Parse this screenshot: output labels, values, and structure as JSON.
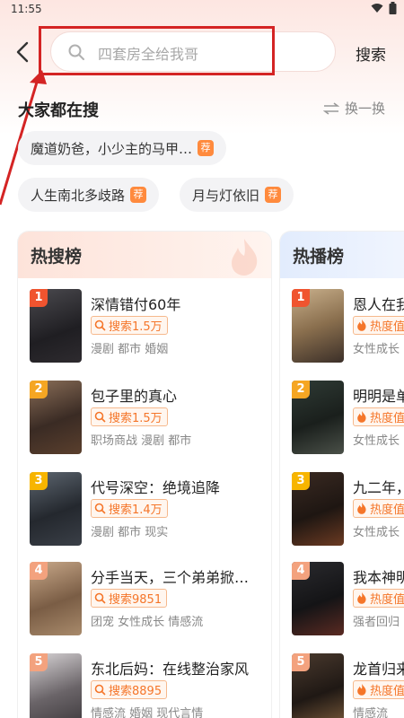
{
  "status": {
    "time": "11:55"
  },
  "search": {
    "placeholder": "四套房全给我哥",
    "button": "搜索"
  },
  "hot": {
    "title": "大家都在搜",
    "refresh": "换一换"
  },
  "chips": [
    {
      "label": "魔道奶爸，小少主的马甲…",
      "tag": "荐"
    },
    {
      "label": "人生南北多歧路",
      "tag": "荐"
    },
    {
      "label": "月与灯依旧",
      "tag": "荐"
    }
  ],
  "rank_left": {
    "title": "热搜榜",
    "items": [
      {
        "rank": "1",
        "title": "深情错付60年",
        "metric": "搜索1.5万",
        "tags": "漫剧 都市 婚姻"
      },
      {
        "rank": "2",
        "title": "包子里的真心",
        "metric": "搜索1.5万",
        "tags": "职场商战 漫剧 都市"
      },
      {
        "rank": "3",
        "title": "代号深空：绝境追降",
        "metric": "搜索1.4万",
        "tags": "漫剧 都市 现实"
      },
      {
        "rank": "4",
        "title": "分手当天，三个弟弟掀…",
        "metric": "搜索9851",
        "tags": "团宠 女性成长 情感流"
      },
      {
        "rank": "5",
        "title": "东北后妈：在线整治家风",
        "metric": "搜索8895",
        "tags": "情感流 婚姻 现代言情"
      }
    ]
  },
  "rank_right": {
    "title": "热播榜",
    "items": [
      {
        "rank": "1",
        "title": "恩人在我",
        "metric": "热度值",
        "tags": "女性成长"
      },
      {
        "rank": "2",
        "title": "明明是单",
        "metric": "热度值",
        "tags": "女性成长"
      },
      {
        "rank": "3",
        "title": "九二年，",
        "metric": "热度值",
        "tags": "女性成长"
      },
      {
        "rank": "4",
        "title": "我本神明",
        "metric": "热度值",
        "tags": "强者回归"
      },
      {
        "rank": "5",
        "title": "龙首归来",
        "metric": "热度值",
        "tags": "情感流"
      }
    ]
  },
  "colors": {
    "rank1": "#f0542f",
    "rank2": "#f5a623",
    "rank3": "#f7b500",
    "rank4": "#f3a27e",
    "rank5": "#f3a27e",
    "accent": "#f5762a",
    "highlight": "#d42424"
  },
  "icons": {
    "back": "chevron-left-icon",
    "search": "search-icon",
    "refresh": "swap-arrows-icon",
    "metric_left": "search-icon",
    "metric_right": "flame-icon"
  }
}
